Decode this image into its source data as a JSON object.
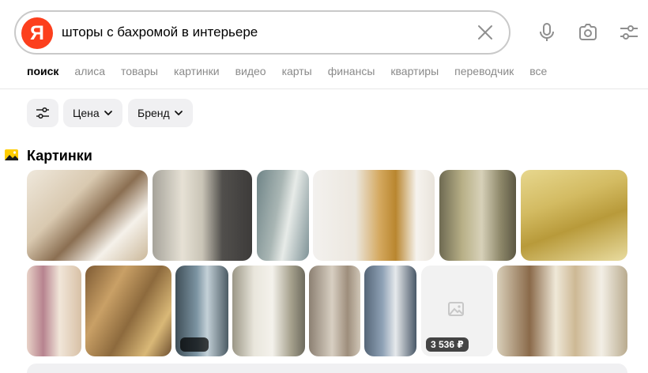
{
  "search": {
    "logo_letter": "Я",
    "query": "шторы с бахромой в интерьере"
  },
  "tabs": [
    {
      "label": "поиск",
      "active": true
    },
    {
      "label": "алиса",
      "active": false
    },
    {
      "label": "товары",
      "active": false
    },
    {
      "label": "картинки",
      "active": false
    },
    {
      "label": "видео",
      "active": false
    },
    {
      "label": "карты",
      "active": false
    },
    {
      "label": "финансы",
      "active": false
    },
    {
      "label": "квартиры",
      "active": false
    },
    {
      "label": "переводчик",
      "active": false
    },
    {
      "label": "все",
      "active": false
    }
  ],
  "filters": {
    "price_label": "Цена",
    "brand_label": "Бренд"
  },
  "images_section": {
    "title": "Картинки",
    "more_count": "3 536 ₽"
  },
  "colors": {
    "brand_red": "#fc3f1d",
    "tab_inactive": "#8a8a8a",
    "chip_bg": "#f0f0f2"
  },
  "icons": [
    "clear-icon",
    "microphone-icon",
    "camera-icon",
    "settings-sliders-icon",
    "filter-sliders-icon",
    "chevron-down-icon",
    "image-icon",
    "image-placeholder-icon"
  ]
}
